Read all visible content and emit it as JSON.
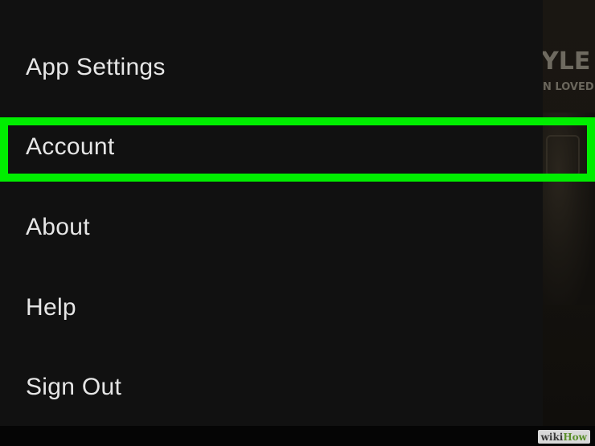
{
  "menu": {
    "items": [
      {
        "label": "App Settings"
      },
      {
        "label": "Account"
      },
      {
        "label": "About"
      },
      {
        "label": "Help"
      },
      {
        "label": "Sign Out"
      }
    ],
    "highlighted_item": "Account"
  },
  "background": {
    "title_fragment": "YLE",
    "subtitle_fragment": "N LOVED"
  },
  "watermark": {
    "part1": "wiki",
    "part2": "How"
  },
  "colors": {
    "drawer": "#111111",
    "menu_text": "#e6e6e6",
    "highlight": "#00ee00"
  }
}
